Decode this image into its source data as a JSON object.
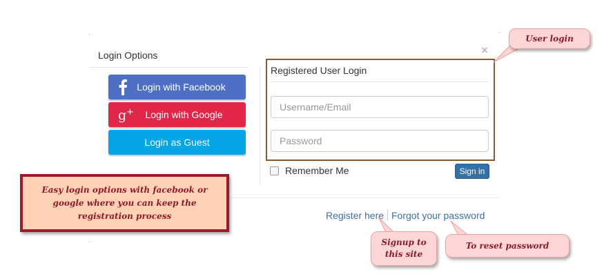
{
  "dialog": {
    "close_glyph": "×",
    "left_title": "Login Options",
    "buttons": {
      "facebook": {
        "label": "Login with Facebook",
        "icon": "facebook-icon",
        "color": "#4d6fc4"
      },
      "google": {
        "label": "Login with Google",
        "icon": "google-plus-icon",
        "color": "#e2264a"
      },
      "guest": {
        "label": "Login as Guest",
        "color": "#04a6e8"
      }
    },
    "registered": {
      "title": "Registered User Login",
      "username_placeholder": "Username/Email",
      "password_placeholder": "Password",
      "remember_label": "Remember Me",
      "signin_label": "Sign in"
    },
    "links": {
      "register": "Register here",
      "forgot": "Forgot your password"
    }
  },
  "annotations": {
    "user_login": "User login",
    "easy_login": "Easy login options with facebook or google where you can keep the registration process",
    "signup_line1": "Signup to",
    "signup_line2": "this site",
    "reset": "To reset password",
    "colors": {
      "text": "#8b1a2a",
      "pink": "#ffd6d6",
      "peach": "#ffd2b5",
      "highlight_border": "#8a5a2b"
    }
  }
}
